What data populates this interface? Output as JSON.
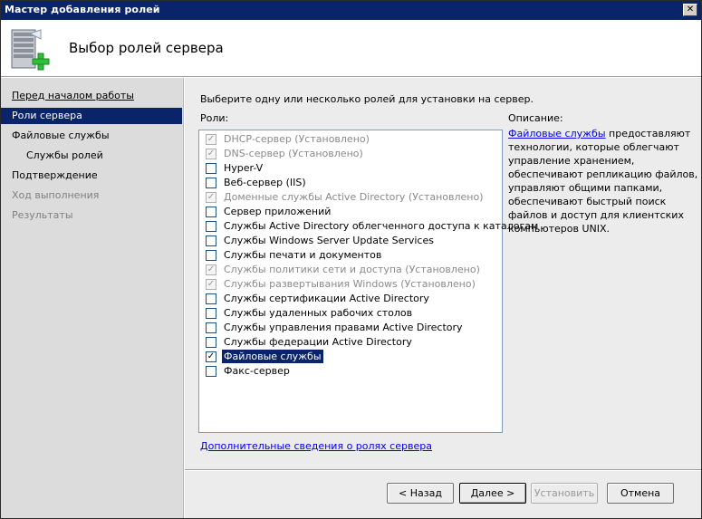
{
  "window": {
    "title": "Мастер добавления ролей",
    "close_glyph": "✕"
  },
  "header": {
    "heading": "Выбор ролей сервера",
    "icon": "server-add-icon"
  },
  "nav": {
    "items": [
      {
        "label": "Перед началом работы",
        "state": "link"
      },
      {
        "label": "Роли сервера",
        "state": "active"
      },
      {
        "label": "Файловые службы",
        "state": "normal"
      },
      {
        "label": "Службы ролей",
        "state": "sub"
      },
      {
        "label": "Подтверждение",
        "state": "normal"
      },
      {
        "label": "Ход выполнения",
        "state": "disabled"
      },
      {
        "label": "Результаты",
        "state": "disabled"
      }
    ]
  },
  "main": {
    "instruction": "Выберите одну или несколько ролей для установки на сервер.",
    "roles_label": "Роли:",
    "roles": [
      {
        "label": "DHCP-сервер  (Установлено)",
        "checked": true,
        "installed": true
      },
      {
        "label": "DNS-сервер  (Установлено)",
        "checked": true,
        "installed": true
      },
      {
        "label": "Hyper-V",
        "checked": false,
        "installed": false
      },
      {
        "label": "Веб-сервер (IIS)",
        "checked": false,
        "installed": false
      },
      {
        "label": "Доменные службы Active Directory  (Установлено)",
        "checked": true,
        "installed": true
      },
      {
        "label": "Сервер приложений",
        "checked": false,
        "installed": false
      },
      {
        "label": "Службы Active Directory облегченного доступа к каталогам",
        "checked": false,
        "installed": false
      },
      {
        "label": "Службы Windows Server Update Services",
        "checked": false,
        "installed": false
      },
      {
        "label": "Службы печати и документов",
        "checked": false,
        "installed": false
      },
      {
        "label": "Службы политики сети и доступа  (Установлено)",
        "checked": true,
        "installed": true
      },
      {
        "label": "Службы развертывания Windows  (Установлено)",
        "checked": true,
        "installed": true
      },
      {
        "label": "Службы сертификации Active Directory",
        "checked": false,
        "installed": false
      },
      {
        "label": "Службы удаленных рабочих столов",
        "checked": false,
        "installed": false
      },
      {
        "label": "Службы управления правами Active Directory",
        "checked": false,
        "installed": false
      },
      {
        "label": "Службы федерации Active Directory",
        "checked": false,
        "installed": false
      },
      {
        "label": "Файловые службы",
        "checked": true,
        "installed": false,
        "selected": true
      },
      {
        "label": "Факс-сервер",
        "checked": false,
        "installed": false
      }
    ],
    "description_label": "Описание:",
    "description_link": "Файловые службы",
    "description_text": " предоставляют технологии, которые облегчают управление хранением, обеспечивают репликацию файлов, управляют общими папками, обеспечивают быстрый поиск файлов и доступ для клиентских компьютеров UNIX.",
    "more_link": "Дополнительные сведения о ролях сервера"
  },
  "footer": {
    "back": "< Назад",
    "next": "Далее >",
    "install": "Установить",
    "cancel": "Отмена"
  }
}
